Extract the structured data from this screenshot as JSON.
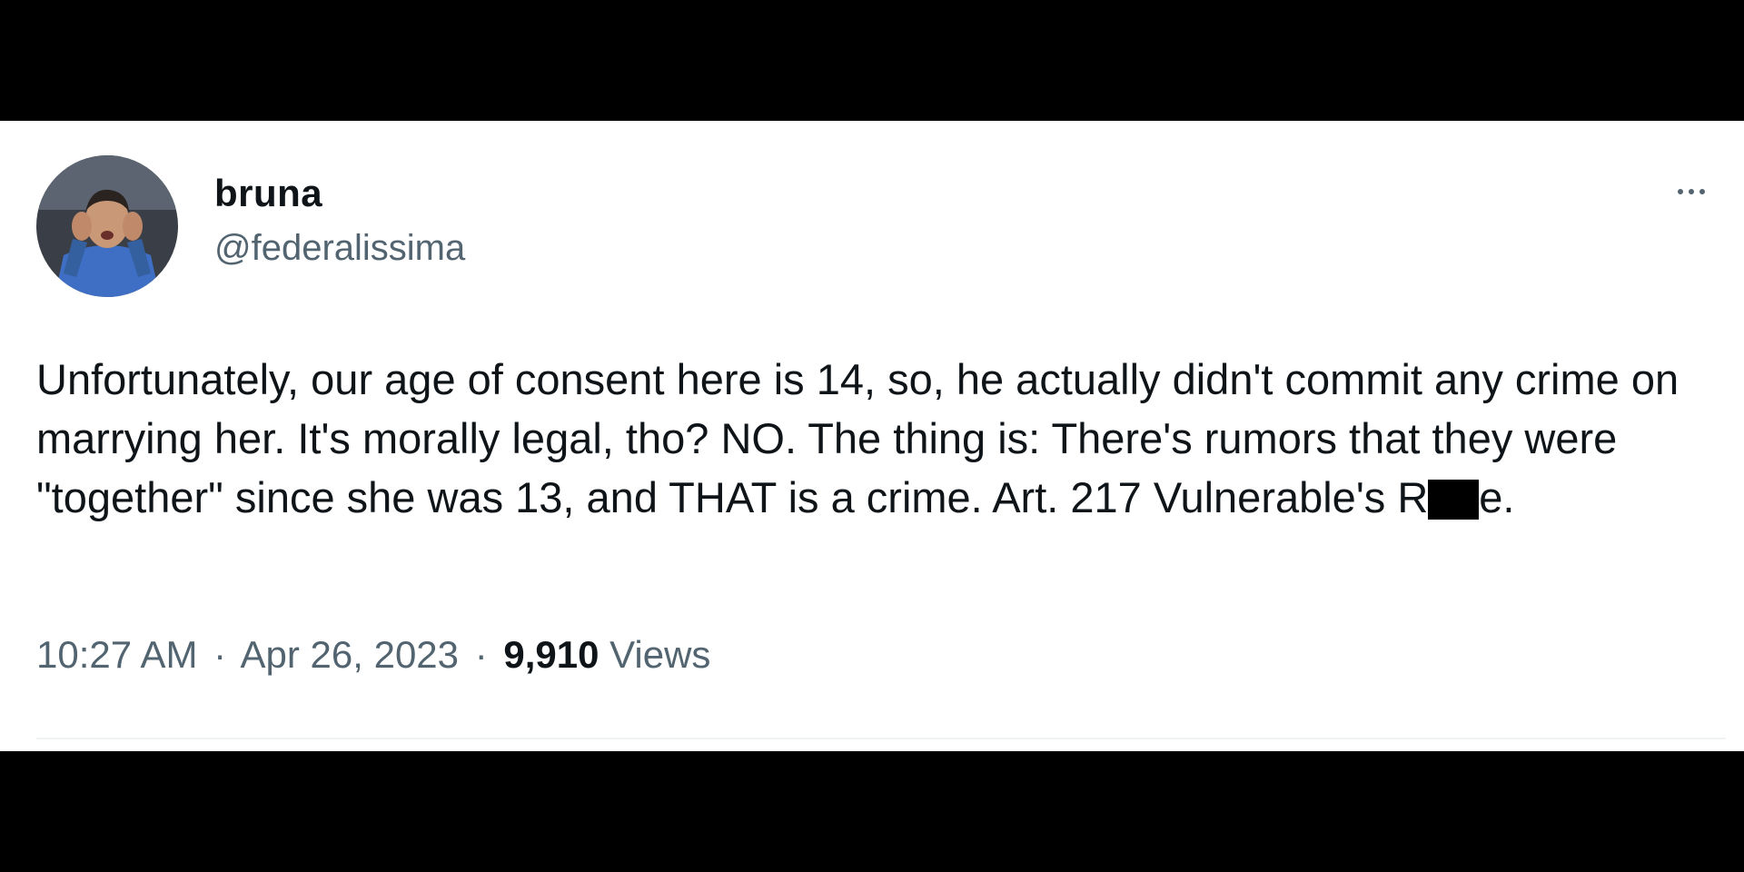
{
  "tweet": {
    "author": {
      "display_name": "bruna",
      "handle": "@federalissima",
      "avatar_icon": "avatar-photo"
    },
    "more_icon": "more-horizontal-icon",
    "text_part1": "Unfortunately, our age of consent here is 14, so, he actually didn't commit any crime on marrying her. It's morally legal, tho? NO. The thing is: There's rumors that they were \"together\" since she was 13, and THAT is a crime. Art. 217 Vulnerable's R",
    "text_part2": "e.",
    "time": "10:27 AM",
    "separator": "·",
    "date": "Apr 26, 2023",
    "views_count": "9,910",
    "views_label": "Views"
  },
  "colors": {
    "text_primary": "#0f1419",
    "text_secondary": "#536471",
    "background": "#ffffff",
    "letterbox": "#000000"
  }
}
